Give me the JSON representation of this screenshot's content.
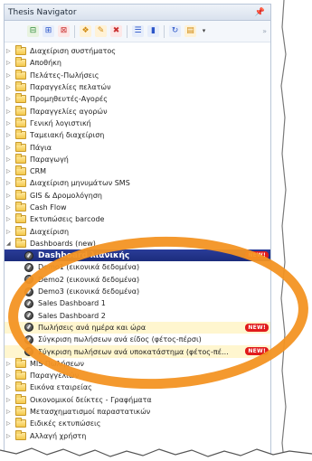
{
  "panel": {
    "title": "Thesis Navigator",
    "pin_icon": "pin-icon"
  },
  "toolbar": {
    "icons": [
      "collapse-all-icon",
      "expand-all-icon",
      "refresh-icon",
      "favorite-add-icon",
      "favorite-edit-icon",
      "favorite-remove-icon",
      "list-view-icon",
      "chart-icon",
      "sync-icon",
      "options-icon"
    ]
  },
  "tree": {
    "folders_top": [
      "Διαχείριση συστήματος",
      "Αποθήκη",
      "Πελάτες-Πωλήσεις",
      "Παραγγελίες πελατών",
      "Προμηθευτές-Αγορές",
      "Παραγγελίες αγορών",
      "Γενική λογιστική",
      "Ταμειακή διαχείριση",
      "Πάγια",
      "Παραγωγή",
      "CRM",
      "Διαχείριση μηνυμάτων SMS",
      "GIS & Δρομολόγηση",
      "Cash Flow",
      "Εκτυπώσεις barcode",
      "Διαχείριση"
    ],
    "dashboards_folder": "Dashboards (new)",
    "dashboards": [
      {
        "label": "Dashboard λιανικής",
        "badge": "NEW!"
      },
      {
        "label": "Demo1 (εικονικά δεδομένα)"
      },
      {
        "label": "Demo2 (εικονικά δεδομένα)"
      },
      {
        "label": "Demo3 (εικονικά δεδομένα)"
      },
      {
        "label": "Sales Dashboard 1"
      },
      {
        "label": "Sales Dashboard 2"
      },
      {
        "label": "Πωλήσεις ανά ημέρα και ώρα",
        "badge": "NEW!"
      },
      {
        "label": "Σύγκριση πωλήσεων ανά είδος (φέτος-πέρσι)"
      },
      {
        "label": "Σύγκριση πωλήσεων ανά υποκατάστημα (φέτος-πέ...",
        "badge": "NEW!"
      }
    ],
    "folders_bottom": [
      "MIS Πωλήσεων",
      "Παραγγελιών",
      "Εικόνα εταιρείας",
      "Οικονομικοί δείκτες - Γραφήματα",
      "Μετασχηματισμοί παραστατικών",
      "Ειδικές εκτυπώσεις",
      "Αλλαγή χρήστη"
    ]
  },
  "colors": {
    "highlight_ring": "#f39423",
    "selected_bg": "#1b2c7c",
    "badge": "#e11b1b",
    "row_highlight": "#fff6cf"
  }
}
